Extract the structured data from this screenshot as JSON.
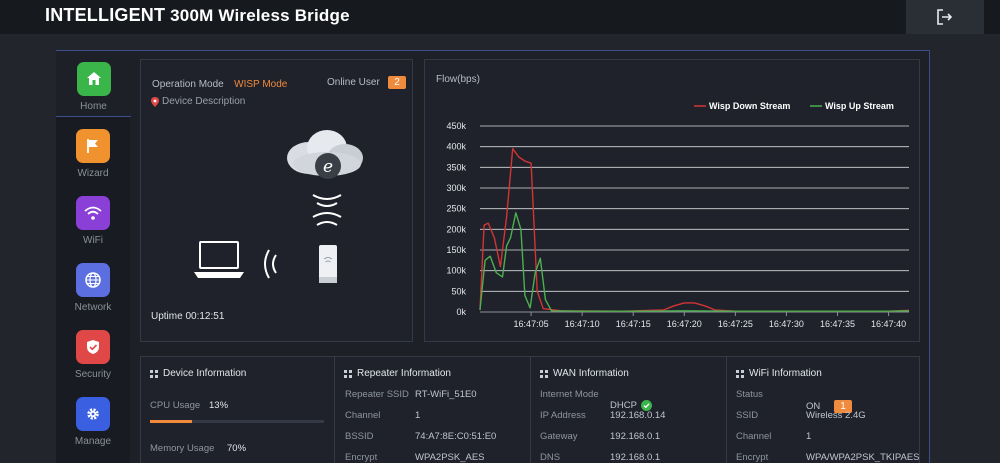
{
  "header": {
    "brand_bold": "INTELLIGENT",
    "brand_rest": "300M Wireless Bridge",
    "logout_icon": "logout-icon"
  },
  "sidebar": {
    "items": [
      {
        "label": "Home",
        "icon": "home-icon",
        "color": "#3ab54a"
      },
      {
        "label": "Wizard",
        "icon": "flag-icon",
        "color": "#f0922e"
      },
      {
        "label": "WiFi",
        "icon": "wifi-icon",
        "color": "#8a3fd6"
      },
      {
        "label": "Network",
        "icon": "globe-icon",
        "color": "#5b6fe0"
      },
      {
        "label": "Security",
        "icon": "shield-icon",
        "color": "#e04848"
      },
      {
        "label": "Manage",
        "icon": "gear-icon",
        "color": "#3a5fe0"
      }
    ]
  },
  "status": {
    "op_mode_label": "Operation Mode",
    "op_mode_value": "WISP Mode",
    "online_user_label": "Online User",
    "online_user_count": "2",
    "device_description": "Device Description",
    "uptime": "Uptime 00:12:51"
  },
  "chart": {
    "title": "Flow(bps)",
    "legend": [
      "Wisp Down Stream",
      "Wisp Up Stream"
    ]
  },
  "chart_data": {
    "type": "line",
    "title": "Flow(bps)",
    "x": [
      "16:47:05",
      "16:47:10",
      "16:47:15",
      "16:47:20",
      "16:47:25",
      "16:47:30",
      "16:47:35",
      "16:47:40"
    ],
    "y_ticks": [
      "0k",
      "50k",
      "100k",
      "150k",
      "200k",
      "250k",
      "300k",
      "350k",
      "400k",
      "450k"
    ],
    "ylim": [
      0,
      450000
    ],
    "colors": {
      "down": "#d33434",
      "up": "#4caf50"
    },
    "series": [
      {
        "name": "Wisp Down Stream",
        "points": [
          [
            0,
            5000
          ],
          [
            0.4,
            210000
          ],
          [
            0.8,
            215000
          ],
          [
            1.4,
            180000
          ],
          [
            2.0,
            110000
          ],
          [
            2.6,
            230000
          ],
          [
            3.2,
            395000
          ],
          [
            3.8,
            375000
          ],
          [
            4.4,
            365000
          ],
          [
            5.0,
            360000
          ],
          [
            5.6,
            50000
          ],
          [
            6.2,
            8000
          ],
          [
            8,
            3000
          ],
          [
            14,
            2000
          ],
          [
            18,
            5000
          ],
          [
            19,
            15000
          ],
          [
            20,
            22000
          ],
          [
            21,
            22000
          ],
          [
            22,
            15000
          ],
          [
            23,
            5000
          ],
          [
            25,
            2000
          ],
          [
            30,
            2000
          ],
          [
            35,
            2000
          ],
          [
            40,
            2000
          ],
          [
            42,
            4000
          ]
        ]
      },
      {
        "name": "Wisp Up Stream",
        "points": [
          [
            0,
            5000
          ],
          [
            0.5,
            125000
          ],
          [
            1.0,
            135000
          ],
          [
            1.6,
            95000
          ],
          [
            2.2,
            85000
          ],
          [
            2.6,
            160000
          ],
          [
            3.0,
            180000
          ],
          [
            3.5,
            240000
          ],
          [
            4.0,
            200000
          ],
          [
            4.4,
            40000
          ],
          [
            4.9,
            10000
          ],
          [
            5.4,
            95000
          ],
          [
            5.9,
            130000
          ],
          [
            6.4,
            30000
          ],
          [
            7,
            3000
          ],
          [
            10,
            2000
          ],
          [
            15,
            2000
          ],
          [
            20,
            3000
          ],
          [
            25,
            2000
          ],
          [
            30,
            2000
          ],
          [
            35,
            2000
          ],
          [
            40,
            2000
          ],
          [
            42,
            3000
          ]
        ]
      }
    ]
  },
  "device_info": {
    "title": "Device Information",
    "cpu_label": "CPU Usage",
    "cpu_value": "13%",
    "cpu_pct": 13,
    "mem_label": "Memory Usage",
    "mem_value": "70%",
    "accent": "#f08a3c"
  },
  "repeater": {
    "title": "Repeater Information",
    "rows": [
      {
        "k": "Repeater SSID",
        "v": "RT-WiFi_51E0"
      },
      {
        "k": "Channel",
        "v": "1"
      },
      {
        "k": "BSSID",
        "v": "74:A7:8E:C0:51:E0"
      },
      {
        "k": "Encrypt",
        "v": "WPA2PSK_AES"
      }
    ]
  },
  "wan": {
    "title": "WAN Information",
    "rows": [
      {
        "k": "Internet Mode",
        "v": "DHCP"
      },
      {
        "k": "IP Address",
        "v": "192.168.0.14"
      },
      {
        "k": "Gateway",
        "v": "192.168.0.1"
      },
      {
        "k": "DNS",
        "v": "192.168.0.1"
      }
    ]
  },
  "wifi_info": {
    "title": "WiFi Information",
    "status_label": "Status",
    "status_value": "ON",
    "status_badge": "1",
    "rows": [
      {
        "k": "SSID",
        "v": "Wireless 2.4G"
      },
      {
        "k": "Channel",
        "v": "1"
      },
      {
        "k": "Encrypt",
        "v": "WPA/WPA2PSK_TKIPAES"
      }
    ]
  }
}
